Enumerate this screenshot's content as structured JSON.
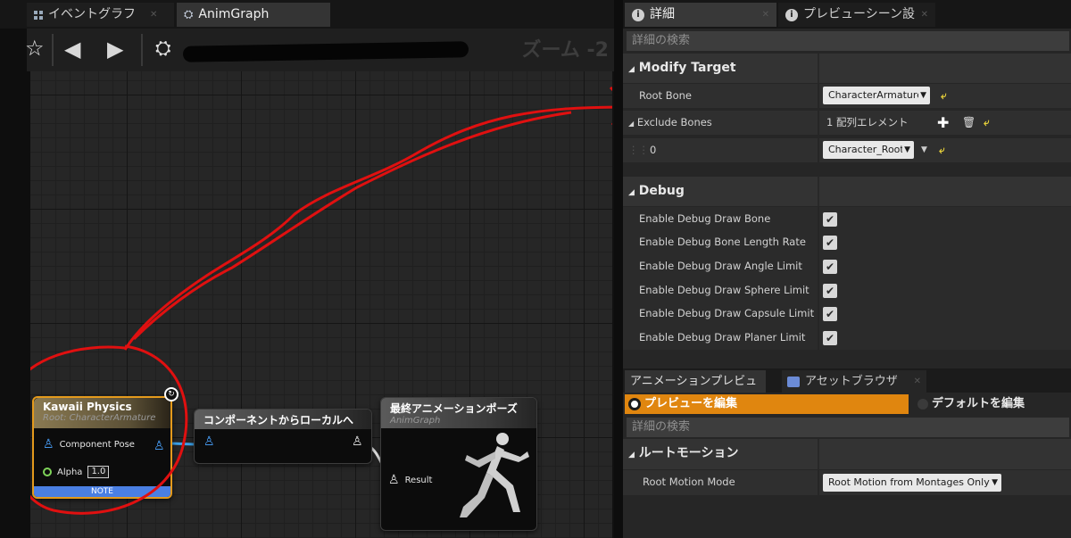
{
  "left_tabs": {
    "event_graph": "イベントグラフ",
    "anim_graph": "AnimGraph"
  },
  "toolbar": {
    "zoom": "ズーム -2"
  },
  "nodes": {
    "kawaii": {
      "title": "Kawaii Physics",
      "subtitle": "Root: CharacterArmature",
      "pin_pose": "Component Pose",
      "pin_alpha": "Alpha",
      "alpha_value": "1.0",
      "note": "NOTE"
    },
    "component_to_local": {
      "title": "コンポーネントからローカルへ"
    },
    "final_pose": {
      "title": "最終アニメーションポーズ",
      "subtitle": "AnimGraph",
      "pin_result": "Result"
    }
  },
  "right_tabs": {
    "details": "詳細",
    "preview_scene": "プレビューシーン設"
  },
  "details": {
    "search_placeholder": "詳細の検索",
    "modify_target": {
      "header": "Modify Target",
      "root_bone_label": "Root Bone",
      "root_bone_value": "CharacterArmature",
      "exclude_bones_label": "Exclude Bones",
      "exclude_bones_value": "1 配列エレメント",
      "index0_label": "0",
      "index0_value": "Character_Root"
    },
    "debug": {
      "header": "Debug",
      "items": [
        {
          "label": "Enable Debug Draw Bone",
          "checked": true
        },
        {
          "label": "Enable Debug Bone Length Rate",
          "checked": true
        },
        {
          "label": "Enable Debug Draw Angle Limit",
          "checked": true
        },
        {
          "label": "Enable Debug Draw Sphere Limit",
          "checked": true
        },
        {
          "label": "Enable Debug Draw Capsule Limit",
          "checked": true
        },
        {
          "label": "Enable Debug Draw Planer Limit",
          "checked": true
        }
      ]
    }
  },
  "lower": {
    "tab_anim_preview": "アニメーションプレビュ",
    "tab_asset_browser": "アセットブラウザ",
    "edit_preview": "プレビューを編集",
    "edit_default": "デフォルトを編集",
    "search_placeholder": "詳細の検索",
    "root_motion_header": "ルートモーション",
    "root_motion_mode_label": "Root Motion Mode",
    "root_motion_mode_value": "Root Motion from Montages Only"
  },
  "colors": {
    "accent_orange": "#e0860f",
    "note_blue": "#4a7fe3",
    "selection_border": "#e49a1c",
    "annotation_red": "#e01010"
  }
}
